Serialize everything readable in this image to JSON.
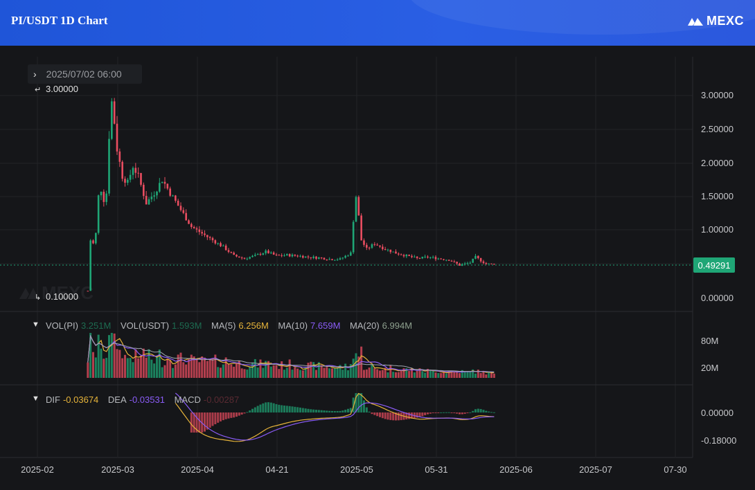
{
  "header": {
    "title": "PI/USDT 1D Chart",
    "brand": "MEXC"
  },
  "chart": {
    "crosshair_date": "2025/07/02 06:00",
    "watermark": "MEXC",
    "max_label": "3.00000",
    "min_label": "0.10000",
    "last_price": "0.49291",
    "colors": {
      "up": "#1fa676",
      "down": "#ea4d60",
      "ma5": "#e7b43a",
      "ma10": "#8a5cf6",
      "ma20": "#a1a7b0"
    }
  },
  "volume_legend": {
    "vol_pi_label": "VOL(PI)",
    "vol_pi_value": "3.251M",
    "vol_usdt_label": "VOL(USDT)",
    "vol_usdt_value": "1.593M",
    "ma5_label": "MA(5)",
    "ma5_value": "6.256M",
    "ma10_label": "MA(10)",
    "ma10_value": "7.659M",
    "ma20_label": "MA(20)",
    "ma20_value": "6.994M"
  },
  "macd_legend": {
    "dif_label": "DIF",
    "dif_value": "-0.03674",
    "dea_label": "DEA",
    "dea_value": "-0.03531",
    "macd_label": "MACD",
    "macd_value": "-0.00287"
  },
  "price_axis": [
    "3.00000",
    "2.50000",
    "2.00000",
    "1.50000",
    "1.00000",
    "0.00000"
  ],
  "volume_axis": [
    "80M",
    "20M"
  ],
  "macd_axis": [
    "0.00000",
    "-0.18000"
  ],
  "time_axis": [
    "2025-02",
    "2025-03",
    "2025-04",
    "04-21",
    "2025-05",
    "05-31",
    "2025-06",
    "2025-07",
    "07-30"
  ],
  "chart_data": {
    "type": "candlestick",
    "title": "PI/USDT 1D Chart",
    "y_axis": {
      "min": 0.0,
      "max": 3.0,
      "ticks": [
        0.0,
        1.0,
        1.5,
        2.0,
        2.5,
        3.0
      ]
    },
    "x_axis": {
      "start": "2025-02-20",
      "end": "2025-08-05",
      "ticks": [
        "2025-02",
        "2025-03",
        "2025-04",
        "04-21",
        "2025-05",
        "05-31",
        "2025-06",
        "2025-07",
        "07-30"
      ]
    },
    "price_path": [
      [
        "2025-02-20",
        0.1
      ],
      [
        "2025-02-21",
        0.85
      ],
      [
        "2025-02-22",
        0.8
      ],
      [
        "2025-02-23",
        0.95
      ],
      [
        "2025-02-24",
        1.5
      ],
      [
        "2025-02-25",
        1.6
      ],
      [
        "2025-02-26",
        1.45
      ],
      [
        "2025-02-27",
        1.55
      ],
      [
        "2025-02-28",
        2.4
      ],
      [
        "2025-03-01",
        2.9
      ],
      [
        "2025-03-02",
        2.6
      ],
      [
        "2025-03-03",
        2.2
      ],
      [
        "2025-03-05",
        1.8
      ],
      [
        "2025-03-07",
        1.7
      ],
      [
        "2025-03-09",
        1.95
      ],
      [
        "2025-03-11",
        1.8
      ],
      [
        "2025-03-14",
        1.4
      ],
      [
        "2025-03-17",
        1.55
      ],
      [
        "2025-03-20",
        1.75
      ],
      [
        "2025-03-23",
        1.55
      ],
      [
        "2025-03-27",
        1.3
      ],
      [
        "2025-03-31",
        1.05
      ],
      [
        "2025-04-04",
        0.95
      ],
      [
        "2025-04-08",
        0.85
      ],
      [
        "2025-04-12",
        0.75
      ],
      [
        "2025-04-16",
        0.62
      ],
      [
        "2025-04-20",
        0.58
      ],
      [
        "2025-04-24",
        0.62
      ],
      [
        "2025-04-28",
        0.68
      ],
      [
        "2025-05-02",
        0.62
      ],
      [
        "2025-05-06",
        0.63
      ],
      [
        "2025-05-10",
        0.62
      ],
      [
        "2025-05-14",
        0.6
      ],
      [
        "2025-05-18",
        0.59
      ],
      [
        "2025-05-22",
        0.57
      ],
      [
        "2025-05-26",
        0.57
      ],
      [
        "2025-05-30",
        0.66
      ],
      [
        "2025-05-31",
        1.15
      ],
      [
        "2025-06-01",
        1.5
      ],
      [
        "2025-06-02",
        1.2
      ],
      [
        "2025-06-03",
        0.85
      ],
      [
        "2025-06-05",
        0.72
      ],
      [
        "2025-06-08",
        0.8
      ],
      [
        "2025-06-12",
        0.72
      ],
      [
        "2025-06-16",
        0.66
      ],
      [
        "2025-06-20",
        0.62
      ],
      [
        "2025-06-24",
        0.58
      ],
      [
        "2025-06-28",
        0.6
      ],
      [
        "2025-07-02",
        0.58
      ],
      [
        "2025-07-06",
        0.56
      ],
      [
        "2025-07-10",
        0.48
      ],
      [
        "2025-07-14",
        0.52
      ],
      [
        "2025-07-16",
        0.6
      ],
      [
        "2025-07-20",
        0.5
      ],
      [
        "2025-07-23",
        0.49291
      ]
    ],
    "last_price": 0.49291,
    "high_marker": 3.0,
    "low_marker": 0.1
  }
}
